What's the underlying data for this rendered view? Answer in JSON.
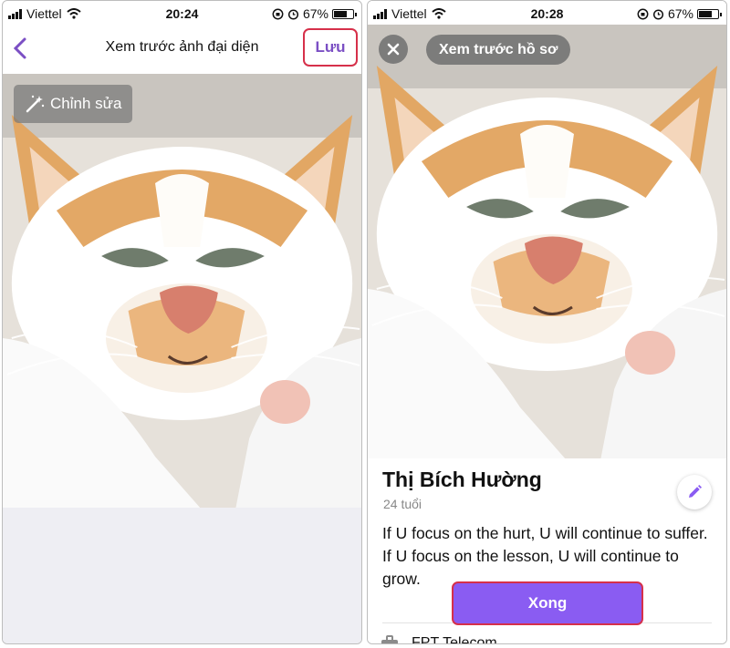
{
  "left": {
    "status": {
      "carrier": "Viettel",
      "time": "20:24",
      "battery": "67%"
    },
    "nav": {
      "title": "Xem trước ảnh đại diện",
      "save_label": "Lưu"
    },
    "edit_label": "Chỉnh sửa"
  },
  "right": {
    "status": {
      "carrier": "Viettel",
      "time": "20:28",
      "battery": "67%"
    },
    "preview_label": "Xem trước hồ sơ",
    "profile": {
      "name": "Thị Bích Hường",
      "age": "24 tuổi",
      "bio_line1": "If U focus on the hurt, U will continue to suffer.",
      "bio_line2": "If U focus on the lesson, U will continue to grow.",
      "work": "FPT Telecom"
    },
    "done_label": "Xong"
  },
  "colors": {
    "accent": "#8a5cf2",
    "highlight": "#d6304a"
  }
}
